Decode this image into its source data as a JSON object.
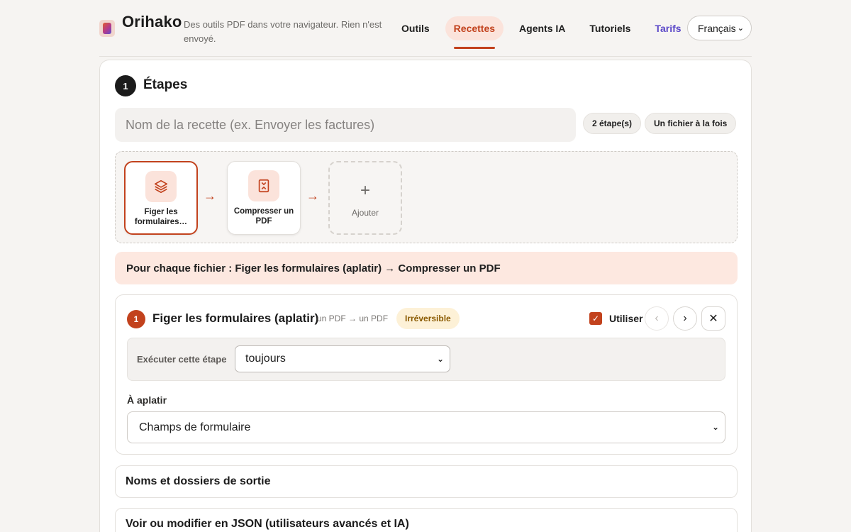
{
  "header": {
    "brand": "Orihako",
    "tagline": "Des outils PDF dans votre navigateur. Rien n'est envoyé.",
    "nav": [
      {
        "label": "Outils"
      },
      {
        "label": "Recettes"
      },
      {
        "label": "Agents IA"
      },
      {
        "label": "Tutoriels"
      },
      {
        "label": "Tarifs"
      }
    ],
    "active_nav": "Recettes",
    "language": "Français"
  },
  "steps_section": {
    "number": "1",
    "title": "Étapes",
    "recipe_name_placeholder": "Nom de la recette (ex. Envoyer les factures)",
    "step_count": "2 étape(s)",
    "mode": "Un fichier à la fois",
    "flow": [
      {
        "label": "Figer les formulaires…",
        "icon": "layers-icon"
      },
      {
        "label": "Compresser un PDF",
        "icon": "compress-icon"
      }
    ],
    "add_label": "Ajouter",
    "summary": "Pour chaque fichier : Figer les formulaires (aplatir) → Compresser un PDF"
  },
  "step_detail": {
    "number": "1",
    "title": "Figer les formulaires (aplatir)",
    "io": "un PDF → un PDF",
    "badge": "Irréversible",
    "use_label": "Utiliser",
    "use_checked": true,
    "prev": "‹",
    "next": "›",
    "close": "✕",
    "run_label": "Exécuter cette étape",
    "run_value": "toujours",
    "flatten_label": "À aplatir",
    "flatten_value": "Champs de formulaire"
  },
  "sections": {
    "outputs": "Noms et dossiers de sortie",
    "json": "Voir ou modifier en JSON (utilisateurs avancés et IA)"
  },
  "colors": {
    "accent": "#c2421d",
    "accent_soft": "#fbe3db",
    "pricing": "#5a47c8",
    "background": "#f6f4f2"
  }
}
